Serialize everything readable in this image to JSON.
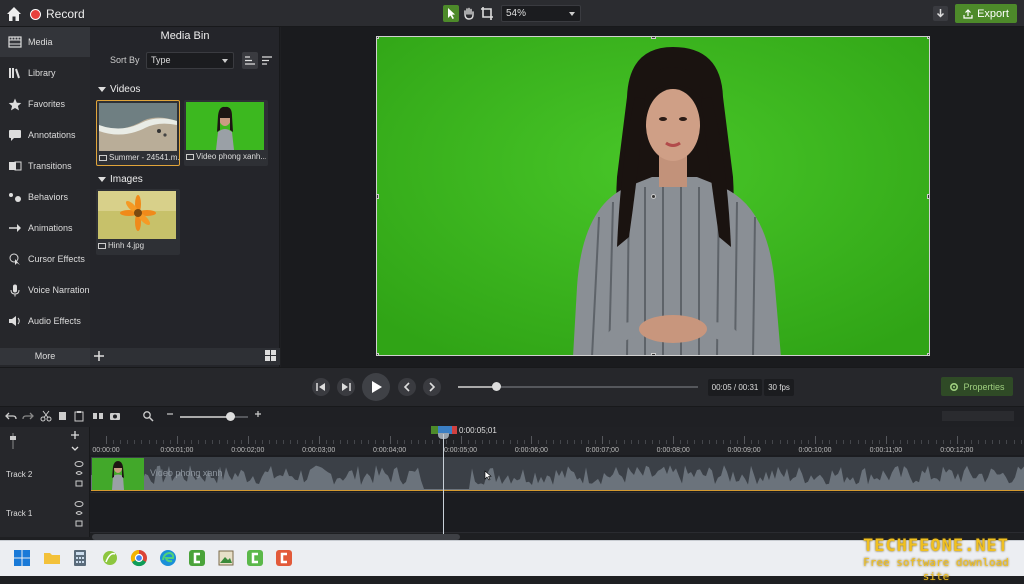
{
  "topbar": {
    "record_label": "Record",
    "zoom_value": "54%",
    "export_label": "Export"
  },
  "nav": {
    "items": [
      {
        "label": "Media",
        "icon": "film-icon"
      },
      {
        "label": "Library",
        "icon": "library-icon"
      },
      {
        "label": "Favorites",
        "icon": "star-icon"
      },
      {
        "label": "Annotations",
        "icon": "annotation-icon"
      },
      {
        "label": "Transitions",
        "icon": "transition-icon"
      },
      {
        "label": "Behaviors",
        "icon": "behavior-icon"
      },
      {
        "label": "Animations",
        "icon": "animation-icon"
      },
      {
        "label": "Cursor Effects",
        "icon": "cursor-icon"
      },
      {
        "label": "Voice Narration",
        "icon": "microphone-icon"
      },
      {
        "label": "Audio Effects",
        "icon": "speaker-icon"
      }
    ],
    "more_label": "More"
  },
  "bin": {
    "title": "Media Bin",
    "sort_label": "Sort By",
    "sort_value": "Type",
    "videos_header": "Videos",
    "images_header": "Images",
    "videos": [
      {
        "name": "Summer - 24541.m..."
      },
      {
        "name": "Video phong xanh..."
      }
    ],
    "images": [
      {
        "name": "Hinh 4.jpg"
      }
    ]
  },
  "playback": {
    "time": "00:05 / 00:31",
    "fps": "30 fps",
    "progress": 0.16,
    "properties_label": "Properties"
  },
  "timeline": {
    "playhead_time": "0:00:05;01",
    "ticks": [
      "00:00:00",
      "0:00:01;00",
      "0:00:02;00",
      "0:00:03;00",
      "0:00:04;00",
      "0:00:05;00",
      "0:00:06;00",
      "0:00:07;00",
      "0:00:08;00",
      "0:00:09;00",
      "0:00:10;00",
      "0:00:11;00",
      "0:00:12;00"
    ],
    "tracks": [
      {
        "label": "Track 2",
        "clip_name": "Video phong xanh"
      },
      {
        "label": "Track 1"
      }
    ]
  },
  "watermark": {
    "title": "TECHFEONE.NET",
    "subtitle": "Free software download site"
  },
  "colors": {
    "accent_green": "#4d8a2a",
    "record_red": "#e8413c",
    "green_screen": "#3cb81f",
    "clip_edge": "#d49a30"
  }
}
